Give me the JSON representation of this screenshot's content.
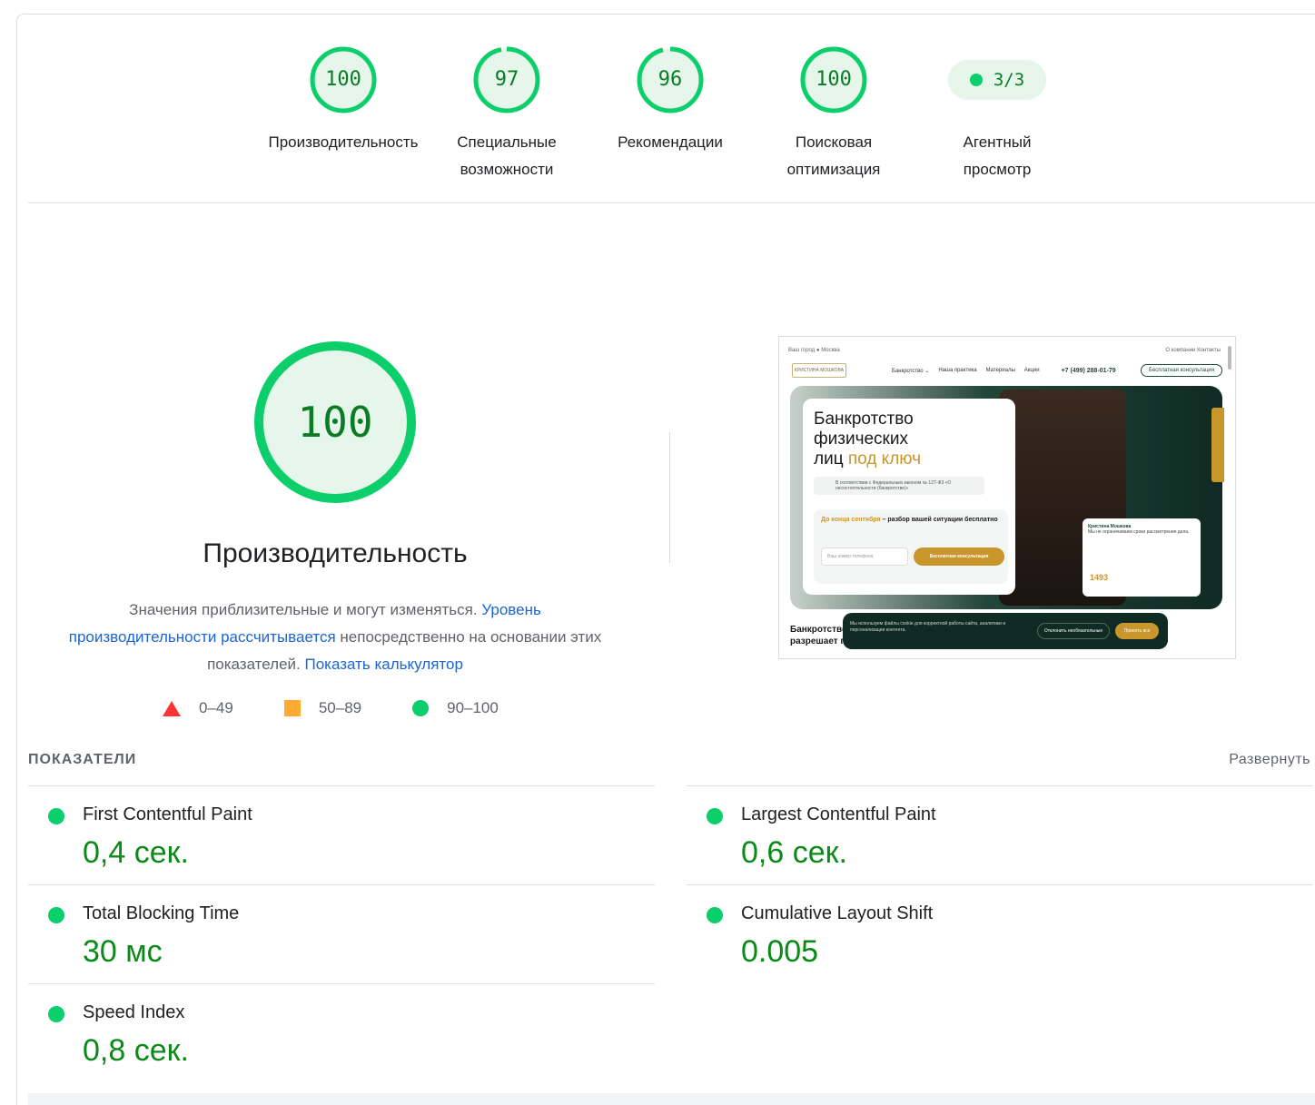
{
  "categories": [
    {
      "score": "100",
      "label_line1": "Производительность",
      "label_line2": "",
      "fraction": 1.0
    },
    {
      "score": "97",
      "label_line1": "Специальные",
      "label_line2": "возможности",
      "fraction": 0.97
    },
    {
      "score": "96",
      "label_line1": "Рекомендации",
      "label_line2": "",
      "fraction": 0.96
    },
    {
      "score": "100",
      "label_line1": "Поисковая",
      "label_line2": "оптимизация",
      "fraction": 1.0
    }
  ],
  "agent": {
    "badge": "3/3",
    "label_line1": "Агентный",
    "label_line2": "просмотр"
  },
  "main": {
    "score": "100",
    "title": "Производительность",
    "desc_text1": "Значения приблизительные и могут изменяться.",
    "desc_link1": "Уровень производительности рассчитывается",
    "desc_text2": "непосредственно на основании этих показателей.",
    "desc_link2": "Показать калькулятор"
  },
  "legend": {
    "fail": "0–49",
    "average": "50–89",
    "pass": "90–100"
  },
  "thumbnail": {
    "city_label": "Ваш город",
    "city": "Москва",
    "top_links": "О компании   Контакты",
    "logo_text": "КРИСТИНА МОШКОВА",
    "nav_links": [
      "Банкротство ⌄",
      "Наша практика",
      "Материалы",
      "Акции"
    ],
    "phone": "+7 (499) 288-01-79",
    "cta": "Бесплатная консультация",
    "hero_line1": "Банкротство",
    "hero_line2": "физических",
    "hero_line3": "лиц",
    "hero_gold": "под ключ",
    "law_note": "В соответствии с Федеральным законом № 127-ФЗ «О несостоятельности (банкротстве)»",
    "offer_gold": "До конца сентября",
    "offer_rest": " – разбор вашей ситуации бесплатно",
    "phone_placeholder": "Ваш номер телефона",
    "offer_button": "Бесплатная консультация",
    "person_name": "Кристина Мошкова",
    "person_note": "Мы не ограничиваем сроки рассмотрения дела.",
    "count": "1493",
    "below_line1": "Банкротство",
    "below_line2": "разрешает п",
    "cookie_text": "Мы используем файлы cookie для корректной работы сайта, аналитики и персонализации контента.",
    "cookie_reject": "Отклонить необязательные",
    "cookie_accept": "Принять все"
  },
  "metrics": {
    "heading": "ПОКАЗАТЕЛИ",
    "expand": "Развернуть",
    "items": [
      {
        "name": "First Contentful Paint",
        "value": "0,4 сек."
      },
      {
        "name": "Largest Contentful Paint",
        "value": "0,6 сек."
      },
      {
        "name": "Total Blocking Time",
        "value": "30 мс"
      },
      {
        "name": "Cumulative Layout Shift",
        "value": "0.005"
      },
      {
        "name": "Speed Index",
        "value": "0,8 сек."
      }
    ]
  },
  "colors": {
    "pass": "#0cce6b",
    "pass_text": "#0a7c25",
    "average": "#ffaa33",
    "fail": "#ff3333",
    "link": "#1a66d6"
  }
}
